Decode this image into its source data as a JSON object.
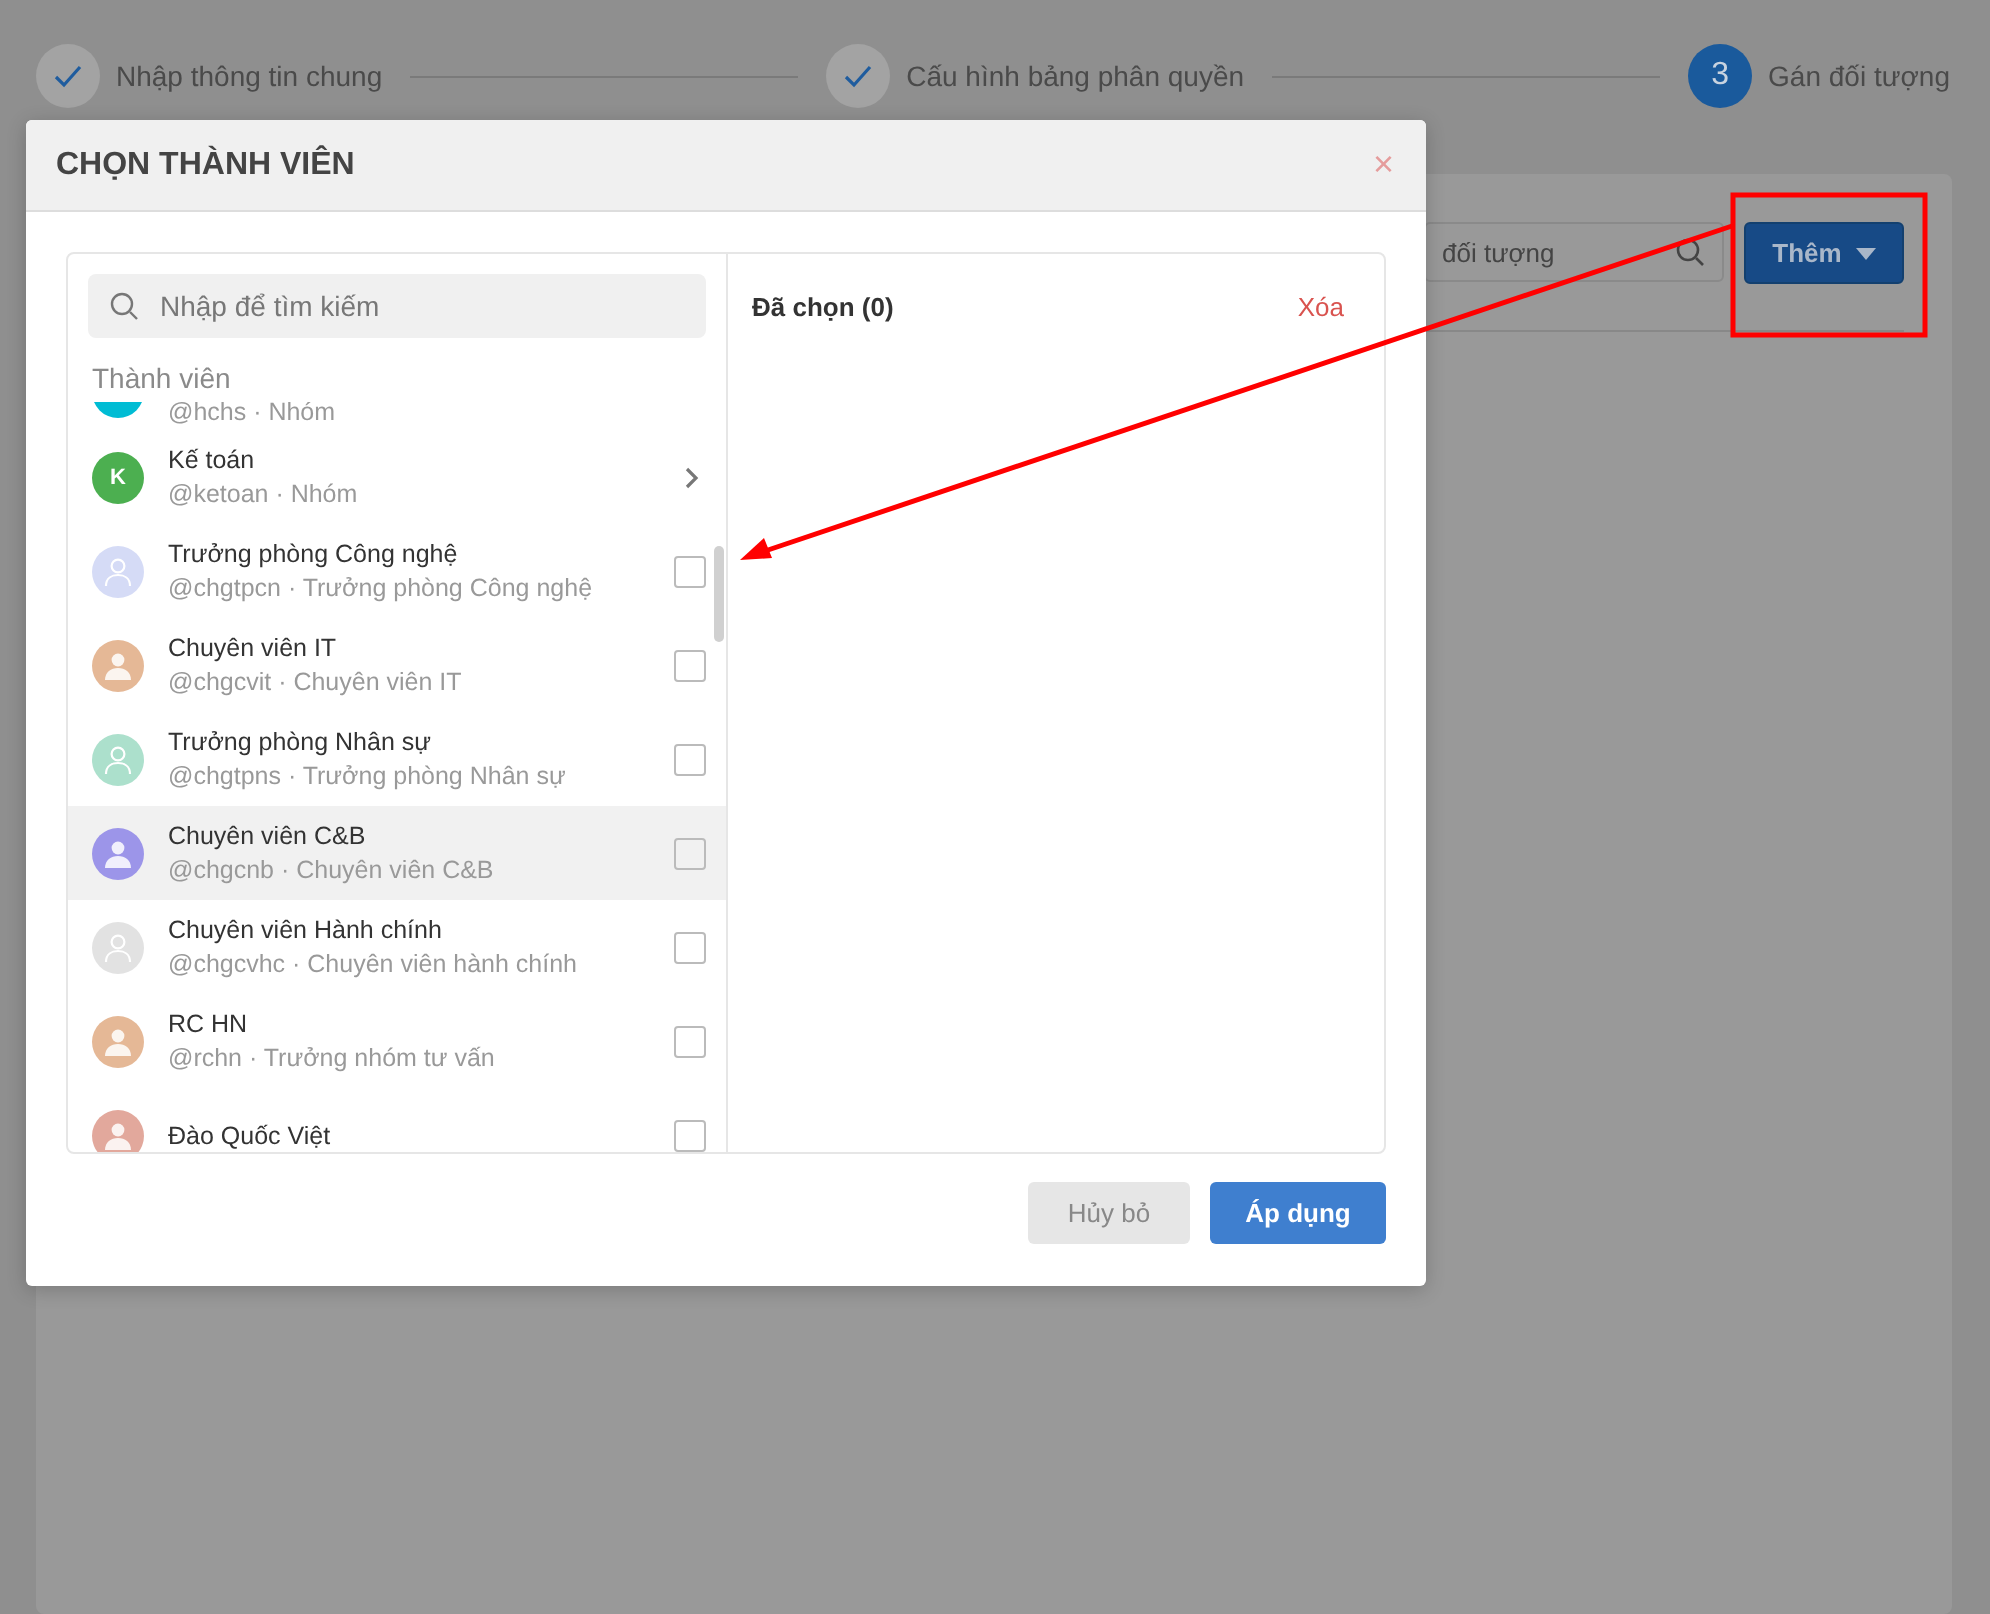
{
  "stepper": [
    {
      "label": "Nhập thông tin chung",
      "done": true,
      "selected": false
    },
    {
      "label": "Cấu hình bảng phân quyền",
      "done": true,
      "selected": false
    },
    {
      "label": "Gán đối tượng",
      "number": "3",
      "done": false,
      "selected": true
    }
  ],
  "page": {
    "search": {
      "value": "đối tượng"
    },
    "add_button": "Thêm"
  },
  "dialog": {
    "title": "CHỌN THÀNH VIÊN",
    "close": "×",
    "search": {
      "placeholder": "Nhập để tìm kiếm"
    },
    "section_label": "Thành viên",
    "members": [
      {
        "kind": "group",
        "avatar": {
          "kind": "letter"
        },
        "color": "#00bcd4",
        "subtitle": "@hchs · Nhóm"
      },
      {
        "kind": "group",
        "avatar": {
          "kind": "letter"
        },
        "color": "#4caf50",
        "initial": "K",
        "name": "Kế toán",
        "subtitle": "@ketoan · Nhóm"
      },
      {
        "kind": "user",
        "avatar": {
          "kind": "outline"
        },
        "color": "#d5dbf6",
        "name": "Trưởng phòng Công nghệ",
        "subtitle": "@chgtpcn · Trưởng phòng Công nghệ",
        "checked": false,
        "hovered": false
      },
      {
        "kind": "user",
        "avatar": {
          "kind": "filled"
        },
        "color": "#e5b896",
        "name": "Chuyên viên IT",
        "subtitle": "@chgcvit · Chuyên viên IT",
        "checked": false,
        "hovered": false
      },
      {
        "kind": "user",
        "avatar": {
          "kind": "outline"
        },
        "color": "#ace0cc",
        "name": "Trưởng phòng Nhân sự",
        "subtitle": "@chgtpns · Trưởng phòng Nhân sự",
        "checked": false,
        "hovered": false
      },
      {
        "kind": "user",
        "avatar": {
          "kind": "filled"
        },
        "color": "#9c95e9",
        "name": "Chuyên viên C&B",
        "subtitle": "@chgcnb · Chuyên viên C&B",
        "checked": false,
        "hovered": true
      },
      {
        "kind": "user",
        "avatar": {
          "kind": "outline"
        },
        "color": "#e2e2e2",
        "name": "Chuyên viên Hành chính",
        "subtitle": "@chgcvhc · Chuyên viên hành chính",
        "checked": false,
        "hovered": false
      },
      {
        "kind": "user",
        "avatar": {
          "kind": "filled"
        },
        "color": "#e5b896",
        "name": "RC HN",
        "subtitle": "@rchn · Trưởng nhóm tư vấn",
        "checked": false,
        "hovered": false
      },
      {
        "kind": "user",
        "avatar": {
          "kind": "filled"
        },
        "color": "#e2a89c",
        "name": "Đào Quốc Việt",
        "checked": false,
        "hovered": false
      }
    ],
    "selected_label": "Đã chọn (0)",
    "clear": "Xóa",
    "buttons": [
      {
        "kind": "secondary",
        "label": "Hủy bỏ",
        "disabled": true
      },
      {
        "kind": "primary",
        "label": "Áp dụng",
        "disabled": false
      }
    ]
  }
}
